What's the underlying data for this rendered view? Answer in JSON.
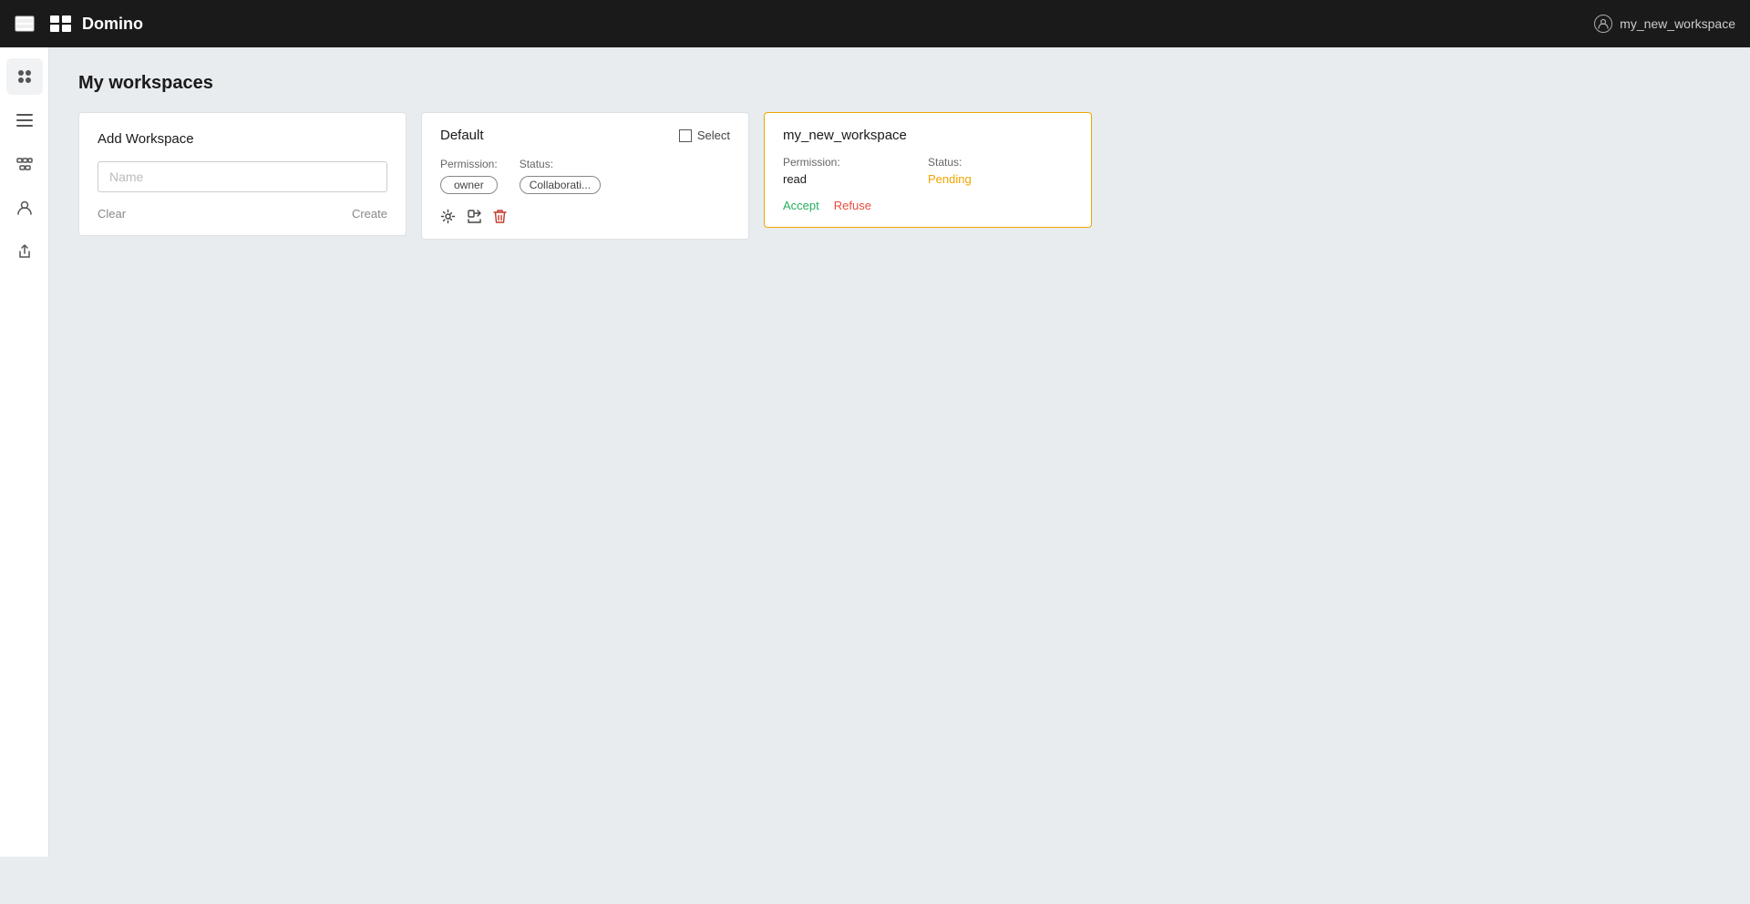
{
  "topnav": {
    "logo_text": "Domino",
    "username": "my_new_workspace"
  },
  "sidebar": {
    "items": [
      {
        "id": "grid",
        "label": "Grid",
        "icon": "grid-icon"
      },
      {
        "id": "list",
        "label": "List",
        "icon": "list-icon"
      },
      {
        "id": "flow",
        "label": "Flow",
        "icon": "flow-icon"
      },
      {
        "id": "user",
        "label": "User",
        "icon": "user-icon"
      },
      {
        "id": "export",
        "label": "Export",
        "icon": "export-icon"
      }
    ]
  },
  "page": {
    "title": "My workspaces"
  },
  "add_workspace_card": {
    "title": "Add Workspace",
    "name_placeholder": "Name",
    "clear_label": "Clear",
    "create_label": "Create"
  },
  "default_workspace_card": {
    "name": "Default",
    "select_label": "Select",
    "permission_label": "Permission:",
    "permission_value": "owner",
    "status_label": "Status:",
    "status_value": "Collaborati..."
  },
  "pending_workspace_card": {
    "name": "my_new_workspace",
    "permission_label": "Permission:",
    "permission_value": "read",
    "status_label": "Status:",
    "status_value": "Pending",
    "accept_label": "Accept",
    "refuse_label": "Refuse"
  }
}
